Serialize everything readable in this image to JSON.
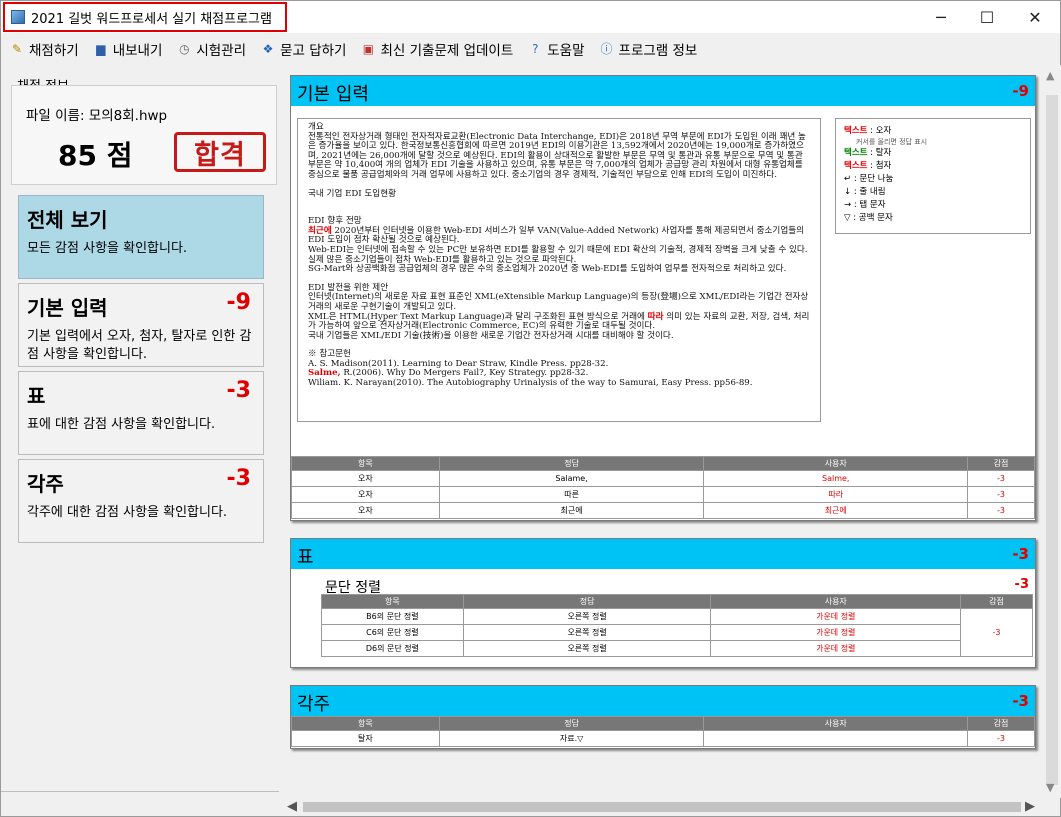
{
  "window": {
    "title": "2021 길벗 워드프로세서 실기 채점프로그램",
    "controls": [
      "─",
      "☐",
      "✕"
    ]
  },
  "menu": [
    {
      "label": "채점하기",
      "icon": "pencil-icon"
    },
    {
      "label": "내보내기",
      "icon": "save-icon"
    },
    {
      "label": "시험관리",
      "icon": "timer-icon"
    },
    {
      "label": "묻고 답하기",
      "icon": "qa-icon"
    },
    {
      "label": "최신 기출문제 업데이트",
      "icon": "gift-icon"
    },
    {
      "label": "도움말",
      "icon": "help-icon"
    },
    {
      "label": "프로그램 정보",
      "icon": "info-icon"
    }
  ],
  "left": {
    "section_label": "채점 정보",
    "file_name": "파일 이름: 모의8회.hwp",
    "score": "85 점",
    "result": "합격",
    "categories": [
      {
        "title": "전체 보기",
        "penalty": "",
        "desc": "모든 감점 사항을 확인합니다."
      },
      {
        "title": "기본 입력",
        "penalty": "-9",
        "desc": "기본 입력에서 오자, 첨자, 탈자로 인한 감점 사항을 확인합니다."
      },
      {
        "title": "표",
        "penalty": "-3",
        "desc": "표에 대한 감점 사항을 확인합니다."
      },
      {
        "title": "각주",
        "penalty": "-3",
        "desc": "각주에 대한 감점 사항을 확인합니다."
      }
    ]
  },
  "basic": {
    "title": "기본 입력",
    "penalty": "-9",
    "doc": {
      "p1": "개요",
      "p2": "전통적인 전자상거래 형태인 전자적자료교환(Electronic Data Interchange, EDI)은 2018년 무역 부문에 EDI가 도입된 이래 꽤년 높은 증가율을 보이고 있다. 한국정보통신흥협회에 따르면 2019년 EDI의 이용기관은 13,592개에서 2020년에는 19,000개로 증가하였으며, 2021년에는 26,000개에 달할 것으로 예상된다. EDI의 활용이 상대적으로 활발한 부문은 무역 및 통관과 유통 부문으로 무역 및 통관 부문은 약 10,400여 개의 업체가 EDI 기술을 사용하고 있으며, 유통 부문은 약 7,000개의 업체가 공급망 관리 차원에서 대형 유통업체를 중심으로 물품 공급업체와의 거래 업무에 사용하고 있다. 중소기업의 경우 경제적, 기술적인 부담으로 인해 EDI의 도입이 미진하다.",
      "p3": "국내 기업 EDI 도입현황",
      "p4": "EDI 향후 전망",
      "p5_red": "최근에",
      "p5": " 2020년부터 인터넷을 이용한 Web-EDI 서비스가 일부 VAN(Value-Added Network) 사업자를 통해 제공되면서 중소기업들의 EDI 도입이 점차 확산될 것으로 예상된다.",
      "p6": "Web-EDI는 인터넷에 접속할 수 있는 PC만 보유하면 EDI를 활용할 수 있기 때문에 EDI 확산의 기술적, 경제적 장벽을 크게 낮출 수 있다.",
      "p7": "실제 많은 중소기업들이 점차 Web-EDI를 활용하고 있는 것으로 파악된다.",
      "p8": "SG-Mart와 상공백화점 공급업체의 경우 많은 수의 중소업체가 2020년 중 Web-EDI를 도입하여 업무를 전자적으로 처리하고 있다.",
      "p9": "EDI 발전을 위한 제안",
      "p10": "인터넷(Internet)의 새로운 자료 표현 표준인 XML(eXtensible Markup Language)의 등장(登場)으로 XML/EDI라는 기업간 전자상거래의 새로운 구현기술이 개발되고 있다.",
      "p11a": "XML은 HTML(Hyper Text Markup Language)과 달리 구조화된 표현 방식으로 거래에 ",
      "p11_red": "따라",
      "p11b": " 의미 있는 자료의 교환, 저장, 검색, 처리가 가능하여 앞으로 전자상거래(Electronic Commerce, EC)의 유력한 기술로 대두될 것이다.",
      "p12": "국내 기업들은 XML/EDI 기술(技術)을 이용한 새로운 기업간 전자상거래 시대를 대비해야 할 것이다.",
      "p13": "※ 참고문헌",
      "p14": "A. S. Madison(2011). Learning to Dear Straw, Kindle Press. pp28-32.",
      "p15_red": "Salme,",
      "p15": " R.(2006). Why Do Mergers Fail?, Key Strategy. pp28-32.",
      "p16": "Wiliam. K. Narayan(2010). The Autobiography Urinalysis of the way to Samurai, Easy Press. pp56-89."
    },
    "legend": {
      "l1_tag": "텍스트",
      "l1": " : 오자",
      "l1_sub": "커서를 올리면 정답 표시",
      "l2_tag": "텍스트",
      "l2": " : 탈자",
      "l3_tag": "텍스트",
      "l3": " : 첨자",
      "l4": "↵ : 문단 나눔",
      "l5": "↓ : 줄 내림",
      "l6": "→ : 탭 문자",
      "l7": "▽ : 공백 문자"
    },
    "table": {
      "headers": [
        "항목",
        "정답",
        "사용자",
        "감점"
      ],
      "rows": [
        [
          "오자",
          "Salame,",
          "Salme,",
          "-3"
        ],
        [
          "오자",
          "따른",
          "따라",
          "-3"
        ],
        [
          "오자",
          "최근에",
          "최근에",
          "-3"
        ]
      ]
    }
  },
  "table_section": {
    "title": "표",
    "penalty": "-3",
    "subtitle": "문단 정렬",
    "subpenalty": "-3",
    "headers": [
      "항목",
      "정답",
      "사용자",
      "감점"
    ],
    "rows": [
      [
        "B6의 문단 정렬",
        "오른쪽 정렬",
        "가운데 정렬"
      ],
      [
        "C6의 문단 정렬",
        "오른쪽 정렬",
        "가운데 정렬"
      ],
      [
        "D6의 문단 정렬",
        "오른쪽 정렬",
        "가운데 정렬"
      ]
    ],
    "merged_penalty": "-3"
  },
  "footnote": {
    "title": "각주",
    "penalty": "-3",
    "headers": [
      "항목",
      "정답",
      "사용자",
      "감점"
    ],
    "rows": [
      [
        "탈자",
        "자료.▽",
        "",
        "-3"
      ]
    ]
  }
}
